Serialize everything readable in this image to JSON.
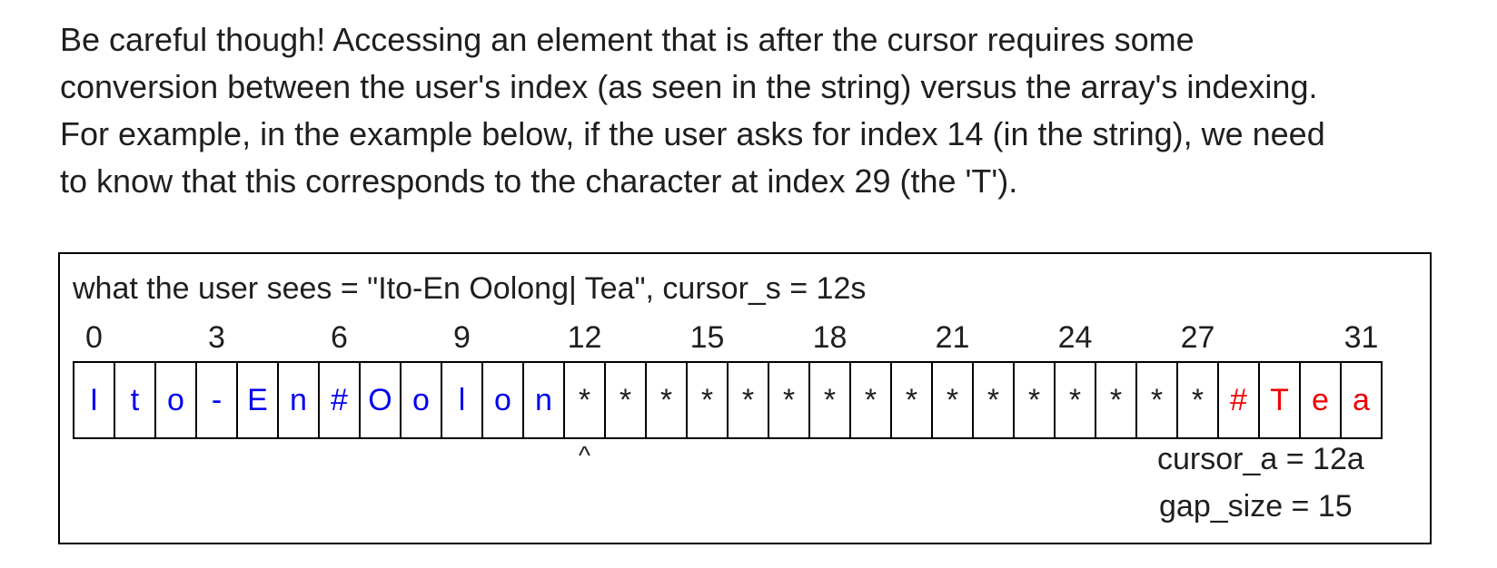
{
  "intro": {
    "lines": [
      "Be careful though! Accessing an element that is after the cursor requires some",
      "conversion between the user's index (as seen in the string) versus the array's indexing.",
      "For example, in the example below, if the user asks for index 14 (in the string), we need",
      "to know that this corresponds to the character at index 29 (the 'T')."
    ]
  },
  "diagram": {
    "caption": "what the user sees = \"Ito-En Oolong| Tea\", cursor_s = 12s",
    "index_labels": [
      {
        "index": 0,
        "label": "0"
      },
      {
        "index": 3,
        "label": "3"
      },
      {
        "index": 6,
        "label": "6"
      },
      {
        "index": 9,
        "label": "9"
      },
      {
        "index": 12,
        "label": "12"
      },
      {
        "index": 15,
        "label": "15"
      },
      {
        "index": 18,
        "label": "18"
      },
      {
        "index": 21,
        "label": "21"
      },
      {
        "index": 24,
        "label": "24"
      },
      {
        "index": 27,
        "label": "27"
      },
      {
        "index": 31,
        "label": "31"
      }
    ],
    "cells": [
      {
        "char": "I",
        "color": "#0000ee"
      },
      {
        "char": "t",
        "color": "#0000ee"
      },
      {
        "char": "o",
        "color": "#0000ee"
      },
      {
        "char": "-",
        "color": "#0000ee"
      },
      {
        "char": "E",
        "color": "#0000ee"
      },
      {
        "char": "n",
        "color": "#0000ee"
      },
      {
        "char": "#",
        "color": "#0000ee"
      },
      {
        "char": "O",
        "color": "#0000ee"
      },
      {
        "char": "o",
        "color": "#0000ee"
      },
      {
        "char": "l",
        "color": "#0000ee"
      },
      {
        "char": "o",
        "color": "#0000ee"
      },
      {
        "char": "n",
        "color": "#0000ee"
      },
      {
        "char": "*",
        "color": "#1f1f1f"
      },
      {
        "char": "*",
        "color": "#1f1f1f"
      },
      {
        "char": "*",
        "color": "#1f1f1f"
      },
      {
        "char": "*",
        "color": "#1f1f1f"
      },
      {
        "char": "*",
        "color": "#1f1f1f"
      },
      {
        "char": "*",
        "color": "#1f1f1f"
      },
      {
        "char": "*",
        "color": "#1f1f1f"
      },
      {
        "char": "*",
        "color": "#1f1f1f"
      },
      {
        "char": "*",
        "color": "#1f1f1f"
      },
      {
        "char": "*",
        "color": "#1f1f1f"
      },
      {
        "char": "*",
        "color": "#1f1f1f"
      },
      {
        "char": "*",
        "color": "#1f1f1f"
      },
      {
        "char": "*",
        "color": "#1f1f1f"
      },
      {
        "char": "*",
        "color": "#1f1f1f"
      },
      {
        "char": "*",
        "color": "#1f1f1f"
      },
      {
        "char": "*",
        "color": "#1f1f1f"
      },
      {
        "char": "#",
        "color": "#ee0000"
      },
      {
        "char": "T",
        "color": "#ee0000"
      },
      {
        "char": "e",
        "color": "#ee0000"
      },
      {
        "char": "a",
        "color": "#ee0000"
      }
    ],
    "caret": "^",
    "caret_index": 12,
    "cursor_a": "cursor_a = 12a",
    "gap_size": "gap_size = 15"
  }
}
